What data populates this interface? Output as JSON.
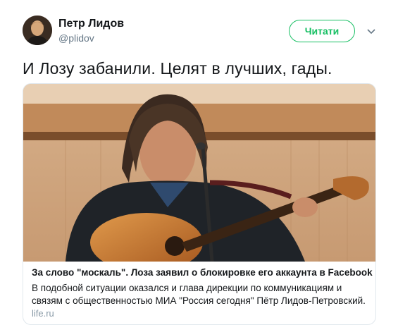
{
  "author": {
    "name": "Петр Лидов",
    "handle": "@plidov"
  },
  "follow_button": {
    "label": "Читати"
  },
  "tweet": {
    "text": "И Лозу забанили. Целят в лучших, гады."
  },
  "card": {
    "title": "За слово \"москаль\". Лоза заявил о блокировке его аккаунта в Facebook",
    "description": "В подобной ситуации оказался и глава дирекции по коммуникациям и связям с общественностью МИА \"Россия сегодня\" Пётр Лидов-Петровский.",
    "domain": "life.ru"
  },
  "colors": {
    "accent": "#17bf63",
    "secondary_text": "#657786",
    "border": "#e1e8ed"
  },
  "icons": {
    "caret": "chevron-down-icon"
  }
}
